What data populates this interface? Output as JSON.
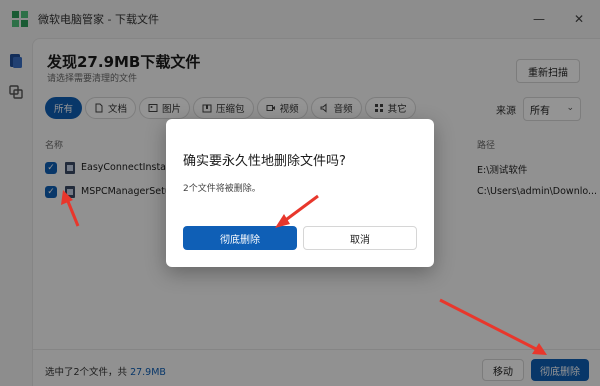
{
  "window": {
    "title": "微软电脑管家 - 下载文件",
    "minimize_icon": "minimize-icon",
    "close_icon": "close-icon"
  },
  "page": {
    "heading": "发现27.9MB下载文件",
    "subheading": "请选择需要清理的文件",
    "rescan_label": "重新扫描"
  },
  "filters": [
    {
      "label": "所有",
      "icon": "",
      "active": true
    },
    {
      "label": "文档",
      "icon": "document-icon"
    },
    {
      "label": "图片",
      "icon": "image-icon"
    },
    {
      "label": "压缩包",
      "icon": "archive-icon"
    },
    {
      "label": "视频",
      "icon": "video-icon"
    },
    {
      "label": "音频",
      "icon": "audio-icon"
    },
    {
      "label": "其它",
      "icon": "grid-icon"
    }
  ],
  "source": {
    "label": "来源",
    "value": "所有"
  },
  "table": {
    "columns": [
      "名称",
      "路径"
    ],
    "rows": [
      {
        "name": "EasyConnectInstaller.ex",
        "path": "E:\\测试软件",
        "checked": true
      },
      {
        "name": "MSPCManagerSetup.ex",
        "path": "C:\\Users\\admin\\Downlo...",
        "checked": true
      }
    ]
  },
  "footer": {
    "sel_prefix": "选中了2个文件，共 ",
    "sel_size": "27.9MB",
    "move_label": "移动",
    "delete_label": "彻底删除"
  },
  "dialog": {
    "title": "确实要永久性地删除文件吗?",
    "description": "2个文件将被删除。",
    "confirm_label": "彻底删除",
    "cancel_label": "取消"
  },
  "colors": {
    "accent": "#0f5fb6",
    "annotation_arrow": "#e8372c"
  }
}
